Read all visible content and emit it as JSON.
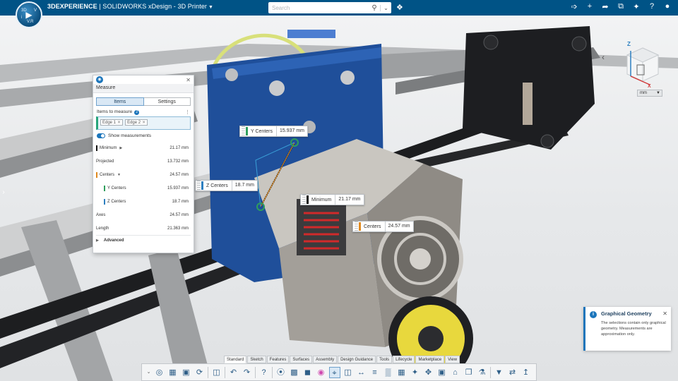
{
  "app": {
    "brand_bold": "3DEXPERIENCE",
    "brand_rest": " | SOLIDWORKS",
    "role": " xDesign - 3D Printer",
    "compass_quadrants": [
      "3D",
      "V",
      "V.R",
      "i"
    ],
    "colors": {
      "topbar": "#005386",
      "accent": "#1b75bb"
    }
  },
  "search": {
    "placeholder": "Search",
    "icon": "search-icon",
    "dropdown_icon": "chevron-down-icon"
  },
  "top_right_icons": [
    "share-icon",
    "add-icon",
    "forward-icon",
    "network-icon",
    "tools-icon",
    "help-icon",
    "user-icon"
  ],
  "viewcube": {
    "axis_z": "Z",
    "axis_x": "X",
    "units": "mm"
  },
  "measure_panel": {
    "title": "Measure",
    "tabs": [
      {
        "label": "Items",
        "active": true
      },
      {
        "label": "Settings",
        "active": false
      }
    ],
    "items_to_measure_label": "Items to measure",
    "selected_items": [
      "Edge 1",
      "Edge 2"
    ],
    "show_measurements_label": "Show measurements",
    "show_measurements_enabled": true,
    "rows": [
      {
        "label": "Minimum",
        "value": "21.17 mm",
        "color": "#111111",
        "expandable": true
      },
      {
        "label": "Projected",
        "value": "13.732 mm",
        "color": "",
        "expandable": false
      },
      {
        "label": "Centers",
        "value": "24.57 mm",
        "color": "#e08a1f",
        "expandable": true
      },
      {
        "label": "Y Centers",
        "value": "15.937 mm",
        "color": "#2e9e5c",
        "expandable": false
      },
      {
        "label": "Z Centers",
        "value": "18.7 mm",
        "color": "#2d7fc0",
        "expandable": false
      },
      {
        "label": "Axes",
        "value": "24.57 mm",
        "color": "",
        "expandable": false
      },
      {
        "label": "Length",
        "value": "21.363 mm",
        "color": "",
        "expandable": false
      }
    ],
    "advanced_label": "Advanced"
  },
  "viewport_labels": {
    "y_centers": {
      "label": "Y Centers",
      "value": "15.937 mm",
      "color": "#2e9e5c"
    },
    "z_centers": {
      "label": "Z Centers",
      "value": "18.7 mm",
      "color": "#2d7fc0"
    },
    "minimum": {
      "label": "Minimum",
      "value": "21.17 mm",
      "color": "#111111"
    },
    "centers": {
      "label": "Centers",
      "value": "24.57 mm",
      "color": "#e08a1f"
    }
  },
  "notification": {
    "title": "Graphical Geometry",
    "body": "The selections contain only graphical geometry. Measurements are approximation only."
  },
  "toolbar": {
    "tabs": [
      {
        "label": "Standard",
        "active": true
      },
      {
        "label": "Sketch",
        "active": false
      },
      {
        "label": "Features",
        "active": false
      },
      {
        "label": "Surfaces",
        "active": false
      },
      {
        "label": "Assembly",
        "active": false
      },
      {
        "label": "Design Guidance",
        "active": false
      },
      {
        "label": "Tools",
        "active": false
      },
      {
        "label": "Lifecycle",
        "active": false
      },
      {
        "label": "Marketplace",
        "active": false
      },
      {
        "label": "View",
        "active": false
      }
    ],
    "tools": [
      "collapse-chevron-icon",
      "globe-icon",
      "open-box-icon",
      "save-icon",
      "sync-icon",
      "sep",
      "mirror-icon",
      "sep",
      "undo-icon",
      "redo-icon",
      "sep",
      "help-circle-icon",
      "sep",
      "lasso-icon",
      "image-icon",
      "solid-icon",
      "appearance-icon",
      "measure-icon",
      "section-icon",
      "dimension-icon",
      "align-icon",
      "hatch-icon",
      "table-icon",
      "explode-icon",
      "move-icon",
      "component-icon",
      "home-icon",
      "copy-icon",
      "mate-icon",
      "sep",
      "filter-icon",
      "replace-icon",
      "export-icon"
    ]
  }
}
